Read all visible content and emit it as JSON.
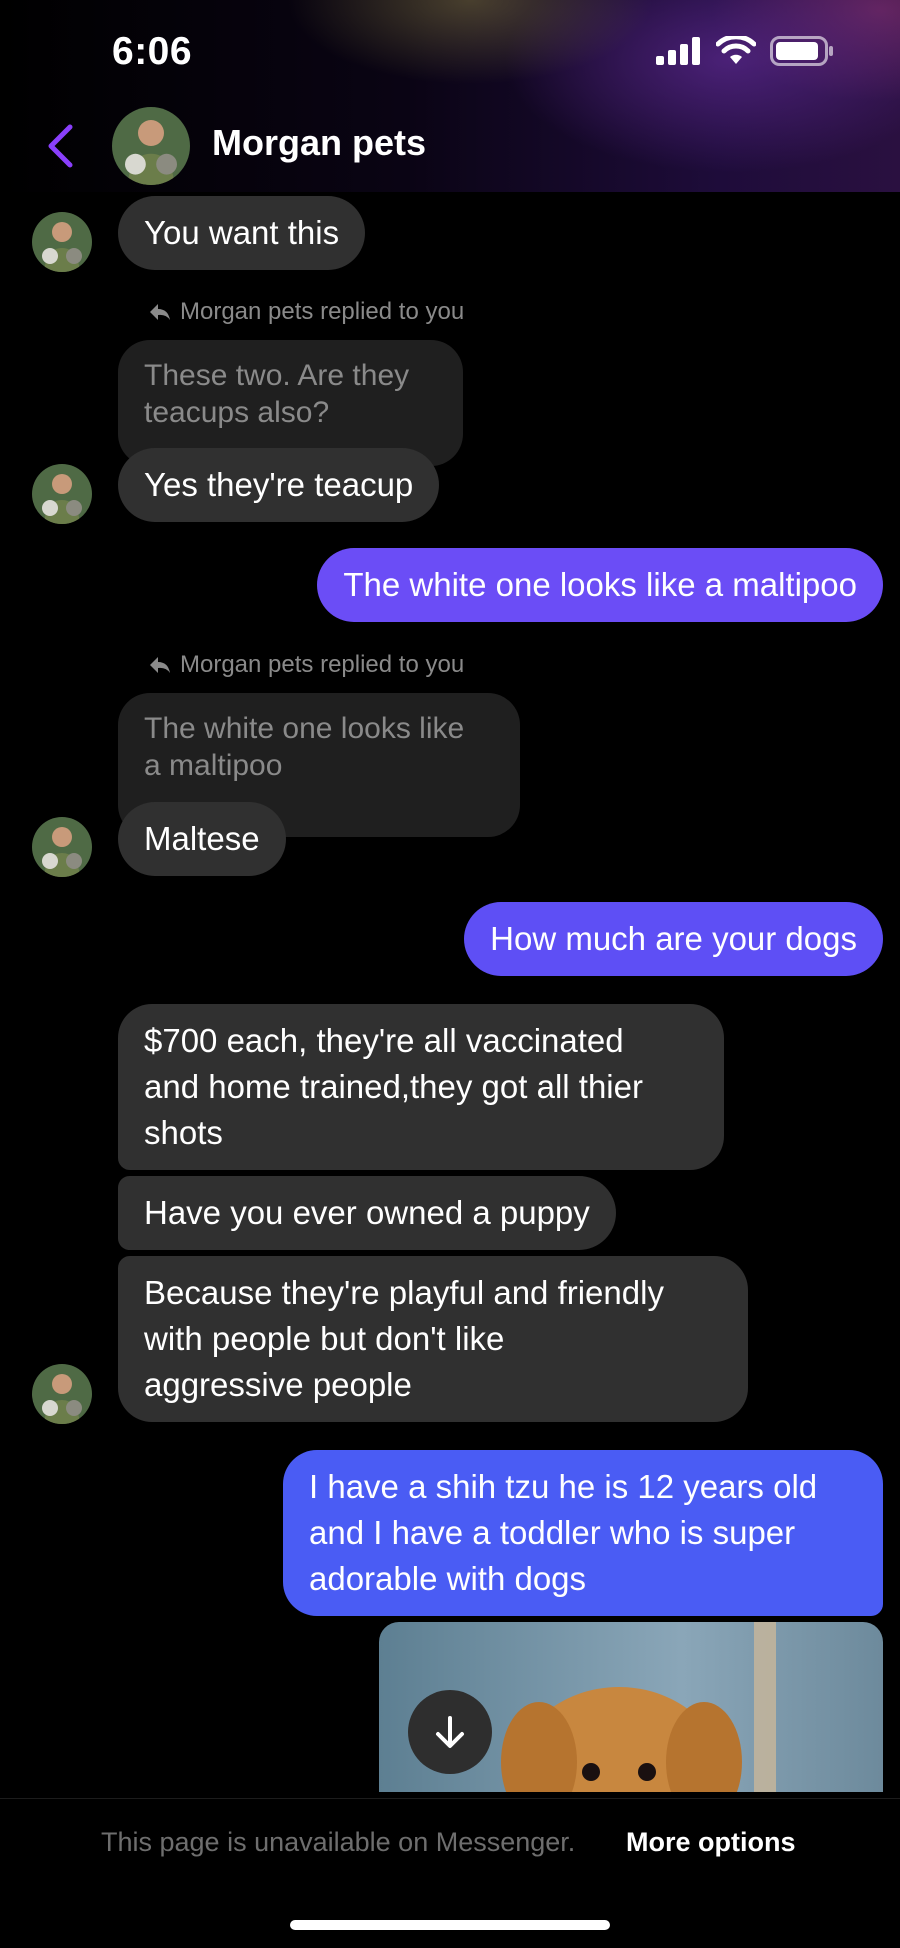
{
  "status": {
    "time": "6:06"
  },
  "header": {
    "contact_name": "Morgan pets"
  },
  "messages": {
    "m1": "You want this",
    "reply_note_1": "Morgan pets replied to you",
    "quote_1": [
      "These two. Are they",
      "teacups also?"
    ],
    "m2": "Yes they're teacup",
    "m3": "The white one looks like a maltipoo",
    "reply_note_2": "Morgan pets replied to you",
    "quote_2": [
      "The white one looks like",
      "a maltipoo"
    ],
    "m4": "Maltese",
    "m5": "How much are your dogs",
    "m6": [
      "$700 each, they're all vaccinated",
      "and home trained,they got all thier",
      "shots"
    ],
    "m7": "Have you ever owned a puppy",
    "m8": [
      "Because they're playful and friendly",
      "with people but don't like",
      "aggressive people"
    ],
    "m9": [
      "I have a shih tzu he is 12 years old",
      "and I have a toddler who is super",
      "adorable with dogs"
    ]
  },
  "footer": {
    "message": "This page is unavailable on Messenger.",
    "link": "More options"
  },
  "colors": {
    "accent": "#8a3ffc",
    "outgoing_purple": "#6b4df6",
    "outgoing_blue": "#4a5cf4",
    "incoming": "#303030"
  }
}
